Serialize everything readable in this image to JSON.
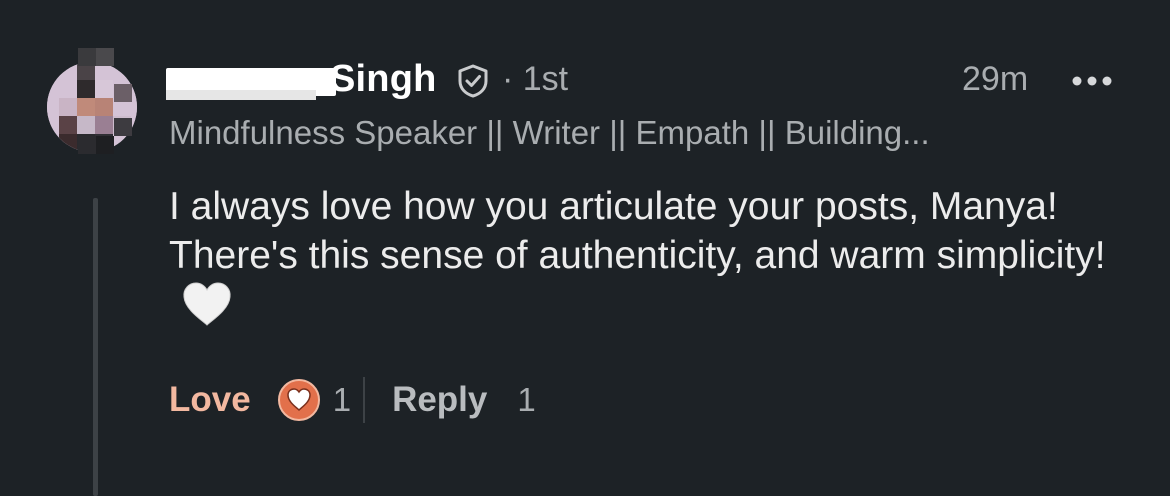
{
  "comment": {
    "author": {
      "name_visible": "Singh",
      "degree": "· 1st",
      "headline": "Mindfulness Speaker || Writer || Empath || Building..."
    },
    "timestamp": "29m",
    "text": "I always love how you articulate your posts, Manya! There's this sense of authenticity, and warm simplicity!",
    "emoji": "white-heart",
    "actions": {
      "reaction_label": "Love",
      "reaction_icon": "love-reaction-icon",
      "reaction_count": "1",
      "reply_label": "Reply",
      "reply_count": "1"
    }
  },
  "colors": {
    "background": "#1d2226",
    "love_accent": "#f2b8a0",
    "love_icon": "#e2704b",
    "muted_text": "#a9adb0"
  }
}
